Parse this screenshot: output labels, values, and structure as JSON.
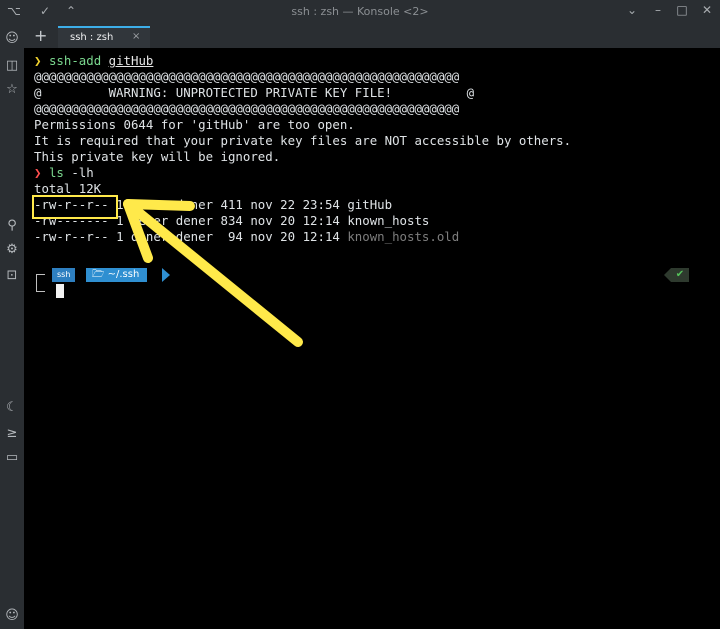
{
  "window": {
    "title": "ssh : zsh — Konsole <2>"
  },
  "titlebar_icons": [
    "terminal-app-icon",
    "pin-icon",
    "keep-above-icon"
  ],
  "window_controls": [
    "chevron-down-icon",
    "minimize-icon",
    "maximize-icon",
    "close-icon"
  ],
  "tabs": [
    {
      "label": "ssh : zsh"
    }
  ],
  "new_tab": "+",
  "tab_close": "×",
  "sidebar_icons": [
    "overview-icon",
    "book-icon",
    "star-icon",
    "search-icon",
    "settings-icon",
    "lock-icon",
    "moon-icon",
    "console-icon",
    "chat-icon",
    "user-icon"
  ],
  "terminal": {
    "prompt_symbol": "❯",
    "cmd1_name": "ssh-add",
    "cmd1_arg": "gitHub",
    "warn_border": "@@@@@@@@@@@@@@@@@@@@@@@@@@@@@@@@@@@@@@@@@@@@@@@@@@@@@@@@@",
    "warn_line": "@         WARNING: UNPROTECTED PRIVATE KEY FILE!          @",
    "perm_msg": "Permissions 0644 for 'gitHub' are too open.",
    "req_msg": "It is required that your private key files are NOT accessible by others.",
    "ignored_msg": "This private key will be ignored.",
    "cmd2_name": "ls",
    "cmd2_arg": "-lh",
    "total": "total 12K",
    "files": [
      {
        "perm": "-rw-r--r--",
        "rest": " 1 dener dener 411 nov 22 23:54 ",
        "name": "gitHub"
      },
      {
        "perm": "-rw-------",
        "rest": " 1 dener dener 834 nov 20 12:14 ",
        "name": "known_hosts"
      },
      {
        "perm": "-rw-r--r--",
        "rest": " 1 dener dener  94 nov 20 12:14 ",
        "name": "known_hosts.old"
      }
    ],
    "pl_user": "ssh",
    "pl_dir": "~/.ssh",
    "pl_status": "✔"
  },
  "colors": {
    "annotation": "#ffe94a",
    "accent": "#3daee9",
    "prompt_ok": "#f0d22e",
    "prompt_err": "#ff4f4f",
    "cmd": "#7bd88f"
  }
}
